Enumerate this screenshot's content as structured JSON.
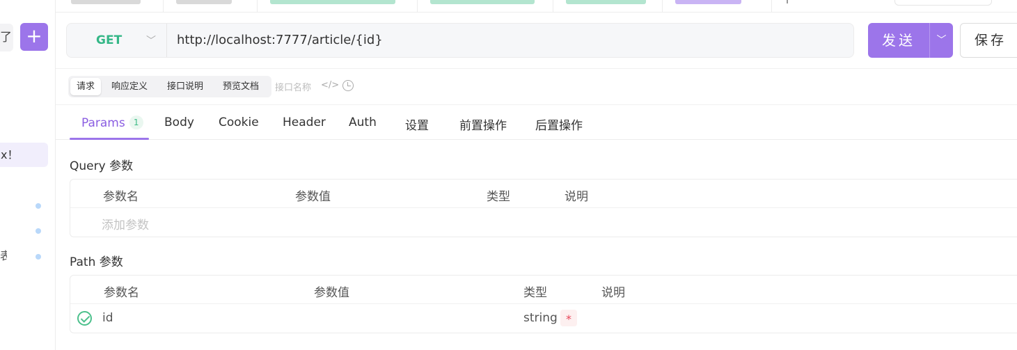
{
  "sidebar": {
    "fragment_top": "了",
    "add_label": "+",
    "highlight_fragment": "x！",
    "fragment_bottom": "表"
  },
  "request": {
    "method": "GET",
    "url": "http://localhost:7777/article/{id}",
    "send_label": "发送",
    "save_label": "保存"
  },
  "segments": {
    "items": [
      "请求",
      "响应定义",
      "接口说明",
      "预览文档"
    ],
    "active": "请求",
    "api_name_placeholder": "接口名称"
  },
  "param_tabs": {
    "items": [
      {
        "label": "Params",
        "badge": "1"
      },
      {
        "label": "Body"
      },
      {
        "label": "Cookie"
      },
      {
        "label": "Header"
      },
      {
        "label": "Auth"
      },
      {
        "label": "设置"
      },
      {
        "label": "前置操作"
      },
      {
        "label": "后置操作"
      }
    ],
    "active": "Params"
  },
  "query": {
    "title": "Query 参数",
    "headers": [
      "参数名",
      "参数值",
      "类型",
      "说明"
    ],
    "add_placeholder": "添加参数"
  },
  "path": {
    "title": "Path 参数",
    "headers": [
      "参数名",
      "参数值",
      "类型",
      "说明"
    ],
    "rows": [
      {
        "name": "id",
        "value": "",
        "type": "string",
        "required_mark": "*",
        "description": "",
        "enabled": true
      }
    ]
  },
  "colors": {
    "accent": "#9c75ea",
    "method_get": "#34b787",
    "required": "#e8465a"
  }
}
